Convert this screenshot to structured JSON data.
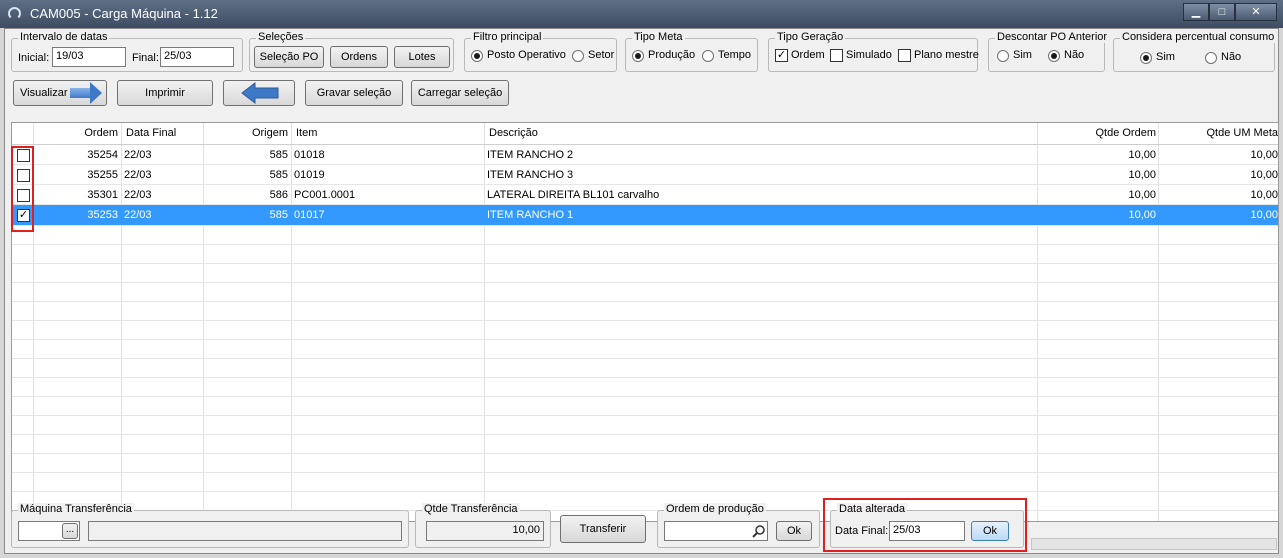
{
  "window": {
    "title": "CAM005 - Carga Máquina - 1.12",
    "minimize": "▁",
    "maximize": "□",
    "close": "✕"
  },
  "intervalo": {
    "legend": "Intervalo de datas",
    "inicial_label": "Inicial:",
    "inicial_value": "19/03",
    "final_label": "Final:",
    "final_value": "25/03"
  },
  "selecoes": {
    "legend": "Seleções",
    "selecao_po": "Seleção PO",
    "ordens": "Ordens",
    "lotes": "Lotes"
  },
  "filtro": {
    "legend": "Filtro principal",
    "posto": "Posto Operativo",
    "setor": "Setor",
    "selected": "Posto Operativo"
  },
  "tipo_meta": {
    "legend": "Tipo Meta",
    "producao": "Produção",
    "tempo": "Tempo",
    "selected": "Produção"
  },
  "tipo_geracao": {
    "legend": "Tipo Geração",
    "ordem": "Ordem",
    "simulado": "Simulado",
    "plano": "Plano mestre",
    "ordem_checked": true
  },
  "descontar": {
    "legend": "Descontar PO Anterior",
    "sim": "Sim",
    "nao": "Não",
    "selected": "Não"
  },
  "considera": {
    "legend": "Considera percentual consumo",
    "sim": "Sim",
    "nao": "Não",
    "selected": "Sim"
  },
  "toolbar": {
    "visualizar": "Visualizar",
    "imprimir": "Imprimir",
    "gravar": "Gravar seleção",
    "carregar": "Carregar seleção"
  },
  "grid": {
    "headers": {
      "ordem": "Ordem",
      "data_final": "Data Final",
      "origem": "Origem",
      "item": "Item",
      "descricao": "Descrição",
      "qtde_ordem": "Qtde Ordem",
      "qtde_um_meta": "Qtde UM Meta"
    },
    "rows": [
      {
        "checked": false,
        "ordem": "35254",
        "data_final": "22/03",
        "origem": "585",
        "item": "01018",
        "descricao": "ITEM RANCHO 2",
        "qtde_ordem": "10,00",
        "qtde_um_meta": "10,00"
      },
      {
        "checked": false,
        "ordem": "35255",
        "data_final": "22/03",
        "origem": "585",
        "item": "01019",
        "descricao": "ITEM RANCHO 3",
        "qtde_ordem": "10,00",
        "qtde_um_meta": "10,00"
      },
      {
        "checked": false,
        "ordem": "35301",
        "data_final": "22/03",
        "origem": "586",
        "item": "PC001.0001",
        "descricao": "LATERAL DIREITA BL101 carvalho",
        "qtde_ordem": "10,00",
        "qtde_um_meta": "10,00"
      },
      {
        "checked": true,
        "ordem": "35253",
        "data_final": "22/03",
        "origem": "585",
        "item": "01017",
        "descricao": "ITEM RANCHO 1",
        "qtde_ordem": "10,00",
        "qtde_um_meta": "10,00"
      }
    ]
  },
  "maquina": {
    "legend": "Máquina Transferência",
    "lookup": "...",
    "code": "",
    "name": ""
  },
  "qtde_transf": {
    "legend": "Qtde Transferência",
    "value": "10,00"
  },
  "transferir": "Transferir",
  "ordem_producao": {
    "legend": "Ordem de produção",
    "value": "",
    "ok": "Ok"
  },
  "data_alterada": {
    "legend": "Data alterada",
    "label": "Data Final:",
    "value": "25/03",
    "ok": "Ok"
  },
  "colors": {
    "selection": "#3399ff",
    "highlight": "#e02020",
    "arrow": "#3e79c8"
  }
}
